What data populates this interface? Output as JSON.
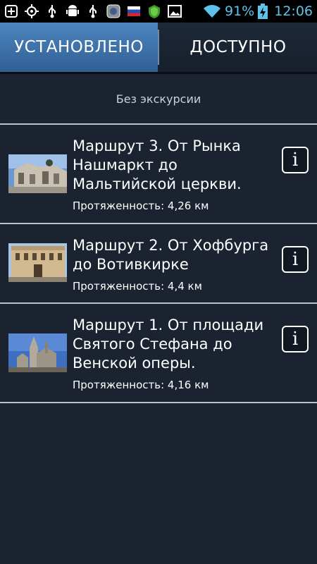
{
  "status_bar": {
    "battery_percent": "91%",
    "time": "12:06",
    "icons": [
      "add-icon",
      "gps-icon",
      "usb-icon",
      "android-debug-icon",
      "usb-icon",
      "app-icon",
      "russia-flag-icon",
      "security-icon",
      "image-icon",
      "wifi-icon",
      "battery-charging-icon"
    ],
    "accent_color": "#5ec3ea"
  },
  "tabs": [
    {
      "label": "УСТАНОВЛЕНО",
      "active": true
    },
    {
      "label": "ДОСТУПНО",
      "active": false
    }
  ],
  "no_tour_label": "Без экскурсии",
  "routes": [
    {
      "title": "Маршрут 3.  От Рынка Нашмаркт до Мальтийской церкви.",
      "length": "Протяженность: 4,26 км",
      "info_icon": "info-icon"
    },
    {
      "title": "Маршрут 2. От Хофбурга до Вотивкирке",
      "length": "Протяженность: 4,4 км",
      "info_icon": "info-icon"
    },
    {
      "title": "Маршрут 1. От площади Святого Стефана до Венской оперы.",
      "length": "Протяженность: 4,16 км",
      "info_icon": "info-icon"
    }
  ],
  "colors": {
    "background": "#1b2330",
    "active_tab": "#3a6fa6",
    "separator": "#b9c2cd"
  }
}
